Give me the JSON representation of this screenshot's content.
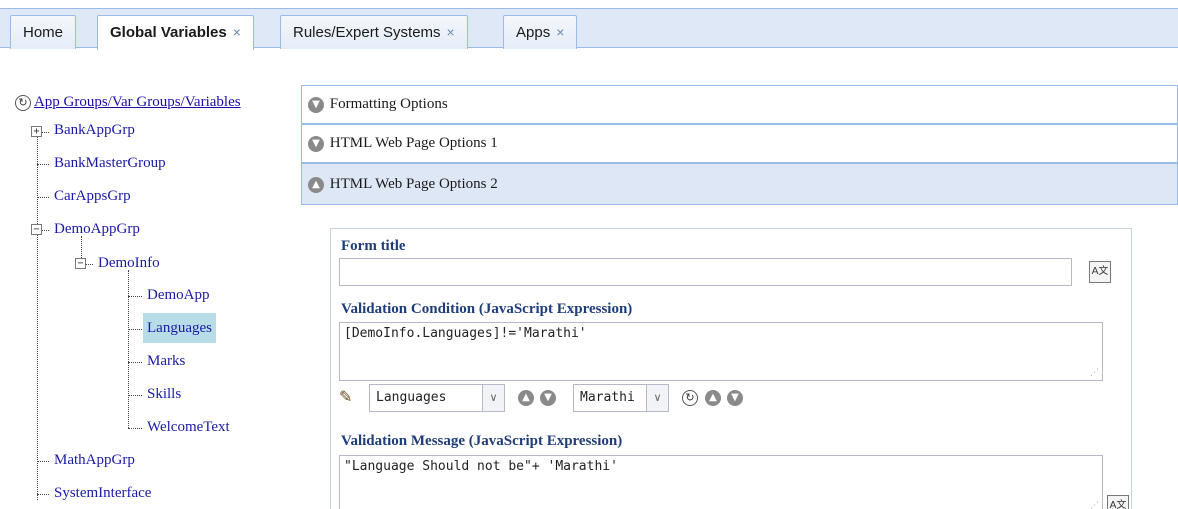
{
  "tabs": [
    {
      "label": "Home",
      "closable": false,
      "active": false
    },
    {
      "label": "Global Variables",
      "closable": true,
      "active": true
    },
    {
      "label": "Rules/Expert Systems",
      "closable": true,
      "active": false
    },
    {
      "label": "Apps",
      "closable": true,
      "active": false
    }
  ],
  "tab_close_glyph": "×",
  "tree": {
    "root_label": "App Groups/Var Groups/Variables",
    "nodes": [
      {
        "label": "BankAppGrp"
      },
      {
        "label": "BankMasterGroup"
      },
      {
        "label": "CarAppsGrp"
      },
      {
        "label": "DemoAppGrp"
      },
      {
        "label": "DemoInfo"
      },
      {
        "label": "DemoApp"
      },
      {
        "label": "Languages",
        "selected": true
      },
      {
        "label": "Marks"
      },
      {
        "label": "Skills"
      },
      {
        "label": "WelcomeText"
      },
      {
        "label": "MathAppGrp"
      },
      {
        "label": "SystemInterface"
      }
    ]
  },
  "accordion": [
    {
      "label": "Formatting Options",
      "expanded": false
    },
    {
      "label": "HTML Web Page Options 1",
      "expanded": false
    },
    {
      "label": "HTML Web Page Options 2",
      "expanded": true
    }
  ],
  "form": {
    "form_title_label": "Form title",
    "form_title_value": "",
    "validation_condition_label": "Validation Condition (JavaScript Expression)",
    "validation_condition_value": "[DemoInfo.Languages]!='Marathi'",
    "variable_combo_value": "Languages",
    "value_combo_value": "Marathi",
    "validation_message_label": "Validation Message (JavaScript Expression)",
    "validation_message_value": "\"Language Should not be\"+ 'Marathi'"
  },
  "colors": {
    "accent": "#99bbe8",
    "tab_bar": "#dfe8f6",
    "selected": "#b8dde7",
    "label": "#1f3d7a"
  }
}
